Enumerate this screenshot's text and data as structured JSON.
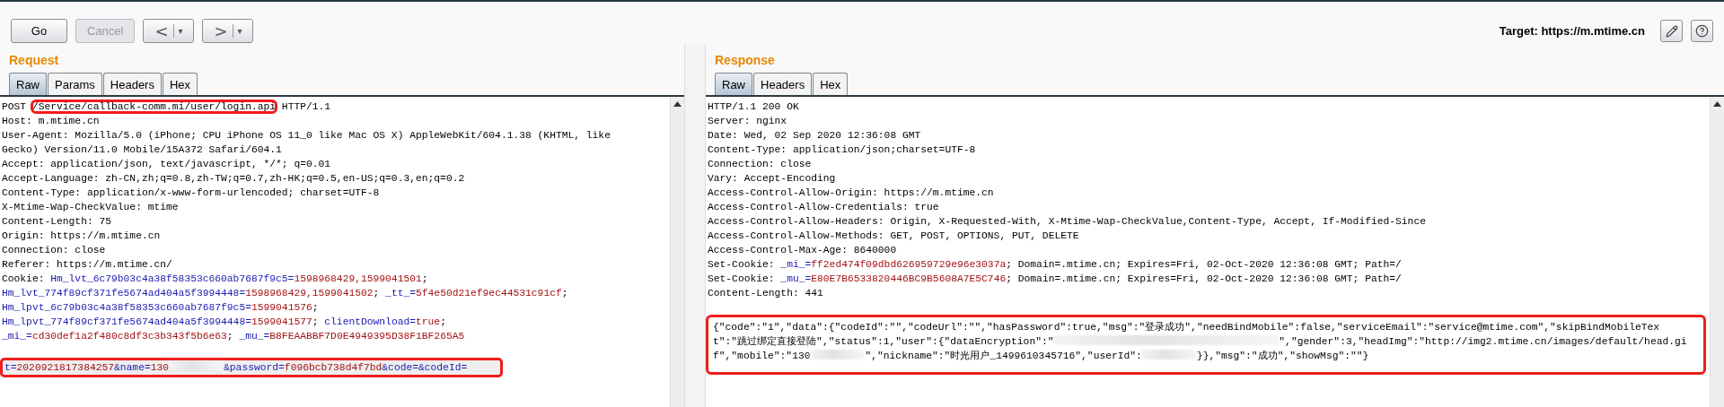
{
  "toolbar": {
    "buttons": [
      {
        "label": "Go",
        "disabled": false
      },
      {
        "label": "Cancel",
        "disabled": true
      }
    ],
    "nav": [
      {
        "label": "<",
        "menu": "▾"
      },
      {
        "label": ">",
        "menu": "▾"
      }
    ],
    "target": "Target: https://m.mtime.cn"
  },
  "request": {
    "title": "Request",
    "tabs": [
      {
        "label": "Raw",
        "selected": true
      },
      {
        "label": "Params",
        "selected": false
      },
      {
        "label": "Headers",
        "selected": false
      },
      {
        "label": "Hex",
        "selected": false
      }
    ],
    "lines": [
      {
        "kind": "code",
        "highlighted": false,
        "boxed": false,
        "segments": [
          {
            "kind": "plain",
            "text": "POST "
          },
          {
            "kind": "boxed",
            "text": "/Service/callback-comm.mi/user/login.api"
          },
          {
            "kind": "plain",
            "text": " HTTP/1.1"
          }
        ]
      },
      {
        "kind": "code",
        "highlighted": false,
        "boxed": false,
        "segments": [
          {
            "kind": "plain",
            "text": "Host: m.mtime.cn"
          }
        ]
      },
      {
        "kind": "code",
        "highlighted": false,
        "boxed": false,
        "segments": [
          {
            "kind": "plain",
            "text": "User-Agent: Mozilla/5.0 (iPhone; CPU iPhone OS 11_0 like Mac OS X) AppleWebKit/604.1.38 (KHTML, like"
          }
        ]
      },
      {
        "kind": "code",
        "highlighted": false,
        "boxed": false,
        "segments": [
          {
            "kind": "plain",
            "text": "Gecko) Version/11.0 Mobile/15A372 Safari/604.1"
          }
        ]
      },
      {
        "kind": "code",
        "highlighted": false,
        "boxed": false,
        "segments": [
          {
            "kind": "plain",
            "text": "Accept: application/json, text/javascript, */*; q=0.01"
          }
        ]
      },
      {
        "kind": "code",
        "highlighted": false,
        "boxed": false,
        "segments": [
          {
            "kind": "plain",
            "text": "Accept-Language: zh-CN,zh;q=0.8,zh-TW;q=0.7,zh-HK;q=0.5,en-US;q=0.3,en;q=0.2"
          }
        ]
      },
      {
        "kind": "code",
        "highlighted": false,
        "boxed": false,
        "segments": [
          {
            "kind": "plain",
            "text": "Content-Type: application/x-www-form-urlencoded; charset=UTF-8"
          }
        ]
      },
      {
        "kind": "code",
        "highlighted": false,
        "boxed": false,
        "segments": [
          {
            "kind": "plain",
            "text": "X-Mtime-Wap-CheckValue: mtime"
          }
        ]
      },
      {
        "kind": "code",
        "highlighted": false,
        "boxed": false,
        "segments": [
          {
            "kind": "plain",
            "text": "Content-Length: 75"
          }
        ]
      },
      {
        "kind": "code",
        "highlighted": false,
        "boxed": false,
        "segments": [
          {
            "kind": "plain",
            "text": "Origin: https://m.mtime.cn"
          }
        ]
      },
      {
        "kind": "code",
        "highlighted": false,
        "boxed": false,
        "segments": [
          {
            "kind": "plain",
            "text": "Connection: close"
          }
        ]
      },
      {
        "kind": "code",
        "highlighted": false,
        "boxed": false,
        "segments": [
          {
            "kind": "plain",
            "text": "Referer: https://m.mtime.cn/"
          }
        ]
      },
      {
        "kind": "code",
        "highlighted": false,
        "boxed": false,
        "segments": [
          {
            "kind": "plain",
            "text": "Cookie: "
          },
          {
            "kind": "name",
            "text": "Hm_lvt_6c79b03c4a38f58353c660ab7687f9c5="
          },
          {
            "kind": "value",
            "text": "1598968429,1599041501"
          },
          {
            "kind": "plain",
            "text": ";"
          }
        ]
      },
      {
        "kind": "code",
        "highlighted": false,
        "boxed": false,
        "segments": [
          {
            "kind": "name",
            "text": "Hm_lvt_774f89cf371fe5674ad404a5f3994448="
          },
          {
            "kind": "value",
            "text": "1598968429,1599041502"
          },
          {
            "kind": "plain",
            "text": "; "
          },
          {
            "kind": "name",
            "text": "_tt_="
          },
          {
            "kind": "value",
            "text": "5f4e50d21ef9ec44531c91cf"
          },
          {
            "kind": "plain",
            "text": ";"
          }
        ]
      },
      {
        "kind": "code",
        "highlighted": false,
        "boxed": false,
        "segments": [
          {
            "kind": "name",
            "text": "Hm_lpvt_6c79b03c4a38f58353c660ab7687f9c5="
          },
          {
            "kind": "value",
            "text": "1599041576"
          },
          {
            "kind": "plain",
            "text": ";"
          }
        ]
      },
      {
        "kind": "code",
        "highlighted": false,
        "boxed": false,
        "segments": [
          {
            "kind": "name",
            "text": "Hm_lpvt_774f89cf371fe5674ad404a5f3994448="
          },
          {
            "kind": "value",
            "text": "1599041577"
          },
          {
            "kind": "plain",
            "text": "; "
          },
          {
            "kind": "name",
            "text": "clientDownload="
          },
          {
            "kind": "value",
            "text": "true"
          },
          {
            "kind": "plain",
            "text": ";"
          }
        ]
      },
      {
        "kind": "code",
        "highlighted": false,
        "boxed": false,
        "segments": [
          {
            "kind": "name",
            "text": "_mi_="
          },
          {
            "kind": "value",
            "text": "cd30def1a2f480c8df3c3b343f5b6e63"
          },
          {
            "kind": "plain",
            "text": "; "
          },
          {
            "kind": "name",
            "text": "_mu_="
          },
          {
            "kind": "value",
            "text": "B8FEAABBF7D0E4949395D38F1BF265A5"
          }
        ]
      },
      {
        "kind": "blank"
      },
      {
        "kind": "code",
        "highlighted": true,
        "boxed": true,
        "segments": [
          {
            "kind": "name",
            "text": "t="
          },
          {
            "kind": "value",
            "text": "2020921817384257"
          },
          {
            "kind": "name",
            "text": "&name="
          },
          {
            "kind": "value",
            "text": "130"
          },
          {
            "kind": "redacted"
          },
          {
            "kind": "name",
            "text": "&password="
          },
          {
            "kind": "value",
            "text": "f096bcb738d4f7bd"
          },
          {
            "kind": "name",
            "text": "&code=&codeId="
          }
        ]
      }
    ]
  },
  "response": {
    "title": "Response",
    "tabs": [
      {
        "label": "Raw",
        "selected": true
      },
      {
        "label": "Headers",
        "selected": false
      },
      {
        "label": "Hex",
        "selected": false
      }
    ],
    "lines": [
      {
        "kind": "code",
        "highlighted": false,
        "boxed": false,
        "segments": [
          {
            "kind": "plain",
            "text": "HTTP/1.1 200 OK"
          }
        ]
      },
      {
        "kind": "code",
        "highlighted": false,
        "boxed": false,
        "segments": [
          {
            "kind": "plain",
            "text": "Server: nginx"
          }
        ]
      },
      {
        "kind": "code",
        "highlighted": false,
        "boxed": false,
        "segments": [
          {
            "kind": "plain",
            "text": "Date: Wed, 02 Sep 2020 12:36:08 GMT"
          }
        ]
      },
      {
        "kind": "code",
        "highlighted": false,
        "boxed": false,
        "segments": [
          {
            "kind": "plain",
            "text": "Content-Type: application/json;charset=UTF-8"
          }
        ]
      },
      {
        "kind": "code",
        "highlighted": false,
        "boxed": false,
        "segments": [
          {
            "kind": "plain",
            "text": "Connection: close"
          }
        ]
      },
      {
        "kind": "code",
        "highlighted": false,
        "boxed": false,
        "segments": [
          {
            "kind": "plain",
            "text": "Vary: Accept-Encoding"
          }
        ]
      },
      {
        "kind": "code",
        "highlighted": false,
        "boxed": false,
        "segments": [
          {
            "kind": "plain",
            "text": "Access-Control-Allow-Origin: https://m.mtime.cn"
          }
        ]
      },
      {
        "kind": "code",
        "highlighted": false,
        "boxed": false,
        "segments": [
          {
            "kind": "plain",
            "text": "Access-Control-Allow-Credentials: true"
          }
        ]
      },
      {
        "kind": "code",
        "highlighted": false,
        "boxed": false,
        "segments": [
          {
            "kind": "plain",
            "text": "Access-Control-Allow-Headers: Origin, X-Requested-With, X-Mtime-Wap-CheckValue,Content-Type, Accept, If-Modified-Since"
          }
        ]
      },
      {
        "kind": "code",
        "highlighted": false,
        "boxed": false,
        "segments": [
          {
            "kind": "plain",
            "text": "Access-Control-Allow-Methods: GET, POST, OPTIONS, PUT, DELETE"
          }
        ]
      },
      {
        "kind": "code",
        "highlighted": false,
        "boxed": false,
        "segments": [
          {
            "kind": "plain",
            "text": "Access-Control-Max-Age: 8640000"
          }
        ]
      },
      {
        "kind": "code",
        "highlighted": false,
        "boxed": false,
        "segments": [
          {
            "kind": "plain",
            "text": "Set-Cookie: "
          },
          {
            "kind": "name",
            "text": "_mi_="
          },
          {
            "kind": "value",
            "text": "ff2ed474f09dbd626959729e96e3037a"
          },
          {
            "kind": "plain",
            "text": "; Domain=.mtime.cn; Expires=Fri, 02-Oct-2020 12:36:08 GMT; Path=/"
          }
        ]
      },
      {
        "kind": "code",
        "highlighted": false,
        "boxed": false,
        "segments": [
          {
            "kind": "plain",
            "text": "Set-Cookie: "
          },
          {
            "kind": "name",
            "text": "_mu_="
          },
          {
            "kind": "value",
            "text": "E80E7B6533820446BC9B5608A7E5C746"
          },
          {
            "kind": "plain",
            "text": "; Domain=.mtime.cn; Expires=Fri, 02-Oct-2020 12:36:08 GMT; Path=/"
          }
        ]
      },
      {
        "kind": "code",
        "highlighted": false,
        "boxed": false,
        "segments": [
          {
            "kind": "plain",
            "text": "Content-Length: 441"
          }
        ]
      },
      {
        "kind": "blank"
      }
    ],
    "body": {
      "boxed": true,
      "lines": [
        {
          "kind": "code",
          "highlighted": false,
          "boxed": false,
          "segments": [
            {
              "kind": "plain",
              "text": "{\"code\":\"1\",\"data\":{\"codeId\":\"\",\"codeUrl\":\"\",\"hasPassword\":true,\"msg\":\"登录成功\",\"needBindMobile\":false,\"serviceEmail\":\"service@mtime.com\",\"skipBindMobileTex"
            }
          ]
        },
        {
          "kind": "code",
          "highlighted": false,
          "boxed": false,
          "segments": [
            {
              "kind": "plain",
              "text": "t\":\"跳过绑定直接登陆\",\"status\":1,\"user\":{\"dataEncryption\":\""
            },
            {
              "kind": "redacted-long"
            },
            {
              "kind": "plain",
              "text": "\",\"gender\":3,\"headImg\":\"http://img2.mtime.cn/images/default/head.gi"
            }
          ]
        },
        {
          "kind": "code",
          "highlighted": false,
          "boxed": false,
          "segments": [
            {
              "kind": "plain",
              "text": "f\",\"mobile\":\"130"
            },
            {
              "kind": "redacted"
            },
            {
              "kind": "plain",
              "text": "\",\"nickname\":\"时光用户_1499610345716\",\"userId\":"
            },
            {
              "kind": "redacted"
            },
            {
              "kind": "plain",
              "text": "}},\"msg\":\"成功\",\"showMsg\":\"\"}"
            }
          ]
        }
      ]
    }
  }
}
